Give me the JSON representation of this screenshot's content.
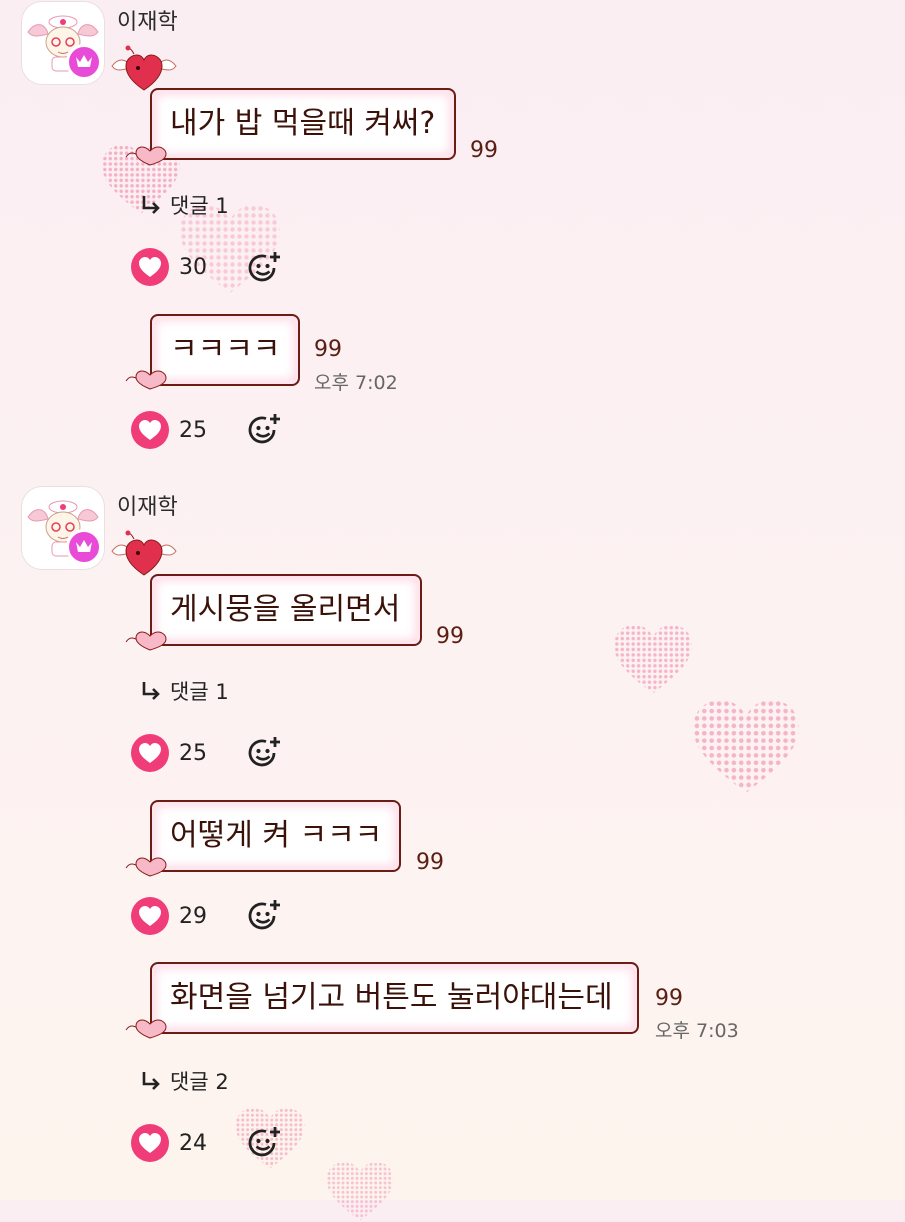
{
  "messages": [
    {
      "sender": "이재학",
      "text": "내가 밥 먹을때 켜써?",
      "read_count": "99",
      "reply_label": "댓글 1",
      "likes": "30"
    },
    {
      "text": "ㅋㅋㅋㅋ",
      "read_count": "99",
      "time": "오후 7:02",
      "likes": "25"
    },
    {
      "sender": "이재학",
      "text": "게시뭉을 올리면서",
      "read_count": "99",
      "reply_label": "댓글 1",
      "likes": "25"
    },
    {
      "text": "어떻게 켜 ㅋㅋㅋ",
      "read_count": "99",
      "likes": "29"
    },
    {
      "text": "화면을 넘기고 버튼도 눌러야대는데",
      "read_count": "99",
      "time": "오후 7:03",
      "reply_label": "댓글 2",
      "likes": "24"
    }
  ],
  "icons": {
    "avatar": "angel-character-avatar",
    "badge": "crown-icon",
    "like": "heart-icon",
    "react": "add-emoji-icon",
    "reply": "reply-arrow-icon"
  },
  "colors": {
    "bubble_border": "#6b1c14",
    "like": "#f03c78",
    "crown_badge": "#e84bd7",
    "text": "#3b1209"
  }
}
